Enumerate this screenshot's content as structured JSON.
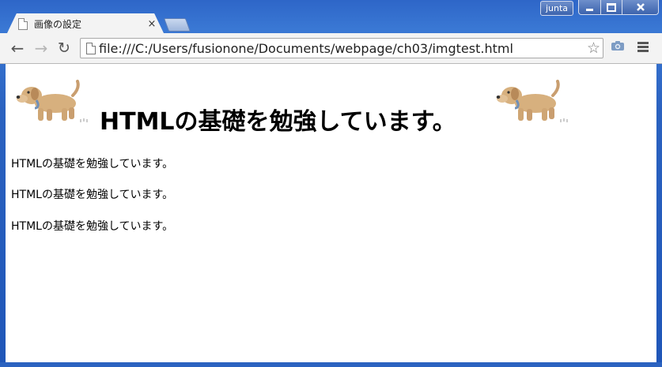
{
  "window": {
    "user_badge": "junta"
  },
  "tab": {
    "title": "画像の設定",
    "close_glyph": "×"
  },
  "toolbar": {
    "back_glyph": "←",
    "forward_glyph": "→",
    "reload_glyph": "↻",
    "url": "file:///C:/Users/fusionone/Documents/webpage/ch03/imgtest.html",
    "star_glyph": "☆"
  },
  "page": {
    "heading": "HTMLの基礎を勉強しています。",
    "paragraphs": [
      "HTMLの基礎を勉強しています。",
      "HTMLの基礎を勉強しています。",
      "HTMLの基礎を勉強しています。"
    ]
  },
  "icons": {
    "tab_page": "page-icon",
    "omnibox_page": "page-icon",
    "bookmark": "star-icon",
    "camera": "camera-icon",
    "menu": "hamburger-menu-icon",
    "image": "dog-icon"
  }
}
